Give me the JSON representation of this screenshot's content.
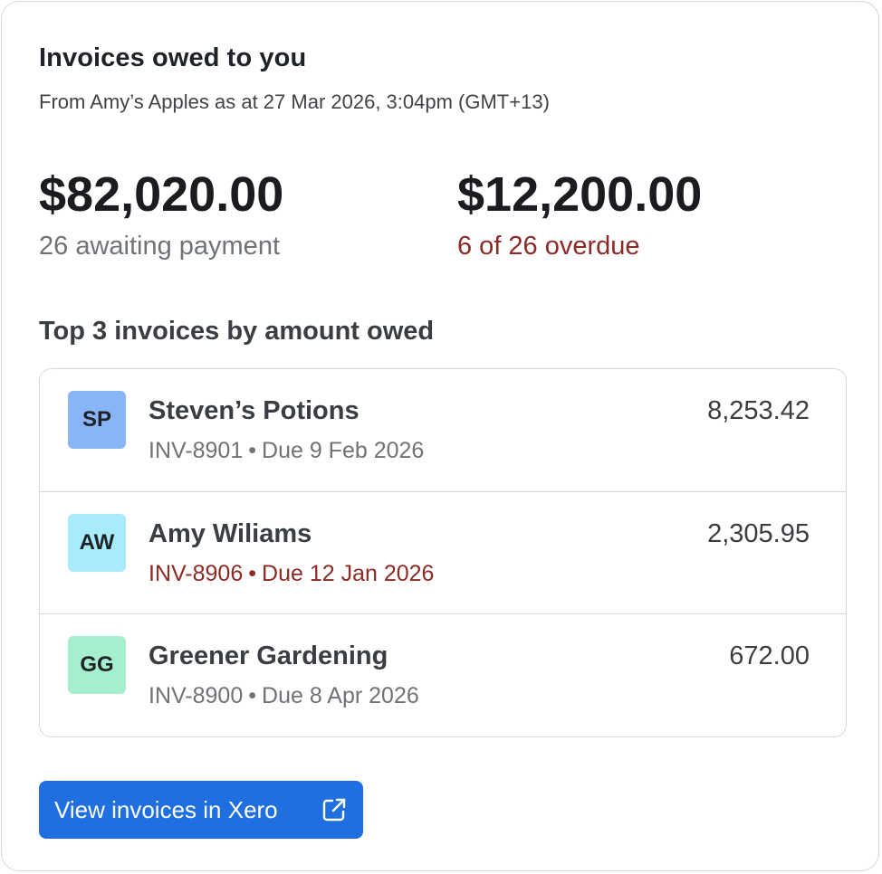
{
  "widget": {
    "title": "Invoices owed to you",
    "subtitle": "From Amy’s Apples as at 27 Mar 2026, 3:04pm (GMT+13)"
  },
  "stats": {
    "awaiting_amount": "$82,020.00",
    "awaiting_caption": "26 awaiting payment",
    "overdue_amount": "$12,200.00",
    "overdue_caption": "6 of 26 overdue"
  },
  "top_invoices": {
    "heading": "Top 3 invoices by amount owed",
    "items": [
      {
        "initials": "SP",
        "name": "Steven’s Potions",
        "invoice": "INV-8901",
        "due": "Due 9 Feb 2026",
        "amount": "8,253.42",
        "avatar_color": "#8ab4f8",
        "overdue": false
      },
      {
        "initials": "AW",
        "name": "Amy Wiliams",
        "invoice": "INV-8906",
        "due": "Due 12 Jan 2026",
        "amount": "2,305.95",
        "avatar_color": "#a8ecfb",
        "overdue": true
      },
      {
        "initials": "GG",
        "name": "Greener Gardening",
        "invoice": "INV-8900",
        "due": "Due 8 Apr 2026",
        "amount": "672.00",
        "avatar_color": "#a6efce",
        "overdue": false
      }
    ]
  },
  "action": {
    "label": "View invoices in Xero",
    "icon": "external-link-icon"
  },
  "colors": {
    "accent": "#1f6fe0",
    "overdue": "#8c2a25",
    "muted": "#6f7378"
  }
}
